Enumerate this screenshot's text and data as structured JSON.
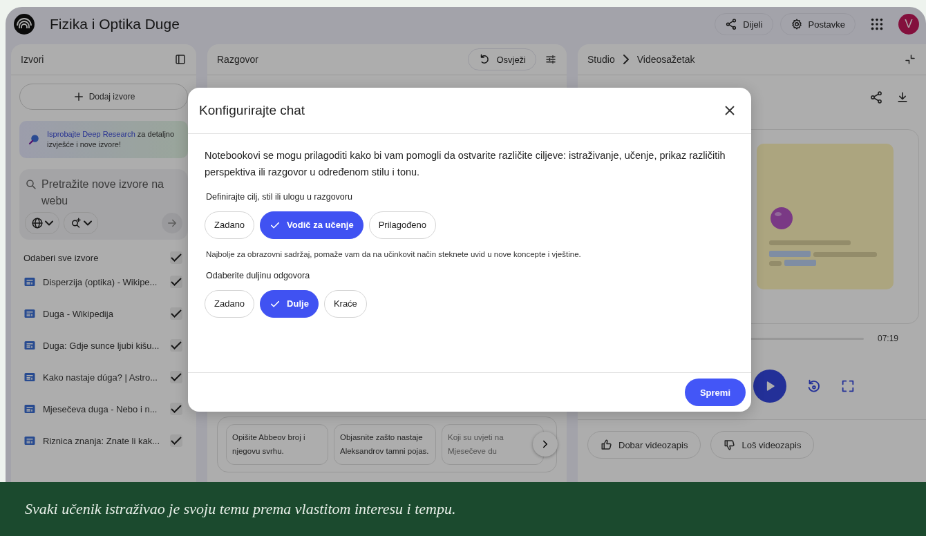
{
  "app": {
    "title": "Fizika i Optika Duge",
    "actions": [
      {
        "kind": "share",
        "label": "Dijeli"
      },
      {
        "kind": "settings",
        "label": "Postavke"
      }
    ],
    "avatar": "V"
  },
  "sources_panel": {
    "title": "Izvori",
    "add_button": "Dodaj izvore",
    "promo": {
      "link": "Isprobajte Deep Research",
      "text": " za detaljno izvješće i nove izvore!"
    },
    "search": {
      "placeholder": "Pretražite nove izvore na webu"
    },
    "select_all": {
      "label": "Odaberi sve izvore",
      "checked": true
    },
    "sources": [
      {
        "title": "Disperzija (optika) - Wikipe...",
        "checked": true
      },
      {
        "title": "Duga - Wikipedija",
        "checked": true
      },
      {
        "title": "Duga: Gdje sunce ljubi kišu...",
        "checked": true
      },
      {
        "title": "Kako nastaje dúga? | Astro...",
        "checked": true
      },
      {
        "title": "Mjesečeva duga - Nebo i n...",
        "checked": true
      },
      {
        "title": "Riznica znanja: Znate li kak...",
        "checked": true
      }
    ]
  },
  "chat_panel": {
    "title": "Razgovor",
    "refresh_button": "Osvježi",
    "suggestions": [
      "Opišite Abbeov broj i njegovu svrhu.",
      "Objasnite zašto nastaje Aleksandrov tamni pojas.",
      "Koji su uvjeti na Mjesečeve du"
    ]
  },
  "studio_panel": {
    "breadcrumb": [
      "Studio",
      "Videosažetak"
    ],
    "duration": "07:19",
    "feedback": [
      {
        "kind": "good",
        "label": "Dobar videozapis"
      },
      {
        "kind": "bad",
        "label": "Loš videozapis"
      }
    ]
  },
  "dialog": {
    "title": "Konfigurirajte chat",
    "intro": "Notebookovi se mogu prilagoditi kako bi vam pomogli da ostvarite različite ciljeve: istraživanje, učenje, prikaz različitih perspektiva ili razgovor u određenom stilu i tonu.",
    "groups": [
      {
        "label": "Definirajte cilj, stil ili ulogu u razgovoru",
        "options": [
          {
            "label": "Zadano",
            "selected": false
          },
          {
            "label": "Vodič za učenje",
            "selected": true
          },
          {
            "label": "Prilagođeno",
            "selected": false
          }
        ],
        "description": "Najbolje za obrazovni sadržaj, pomaže vam da na učinkovit način steknete uvid u nove koncepte i vještine."
      },
      {
        "label": "Odaberite duljinu odgovora",
        "options": [
          {
            "label": "Zadano",
            "selected": false
          },
          {
            "label": "Dulje",
            "selected": true
          },
          {
            "label": "Kraće",
            "selected": false
          }
        ]
      }
    ],
    "save_button": "Spremi"
  },
  "caption": "Svaki učenik istraživao je svoju temu prema vlastitom interesu i tempu."
}
